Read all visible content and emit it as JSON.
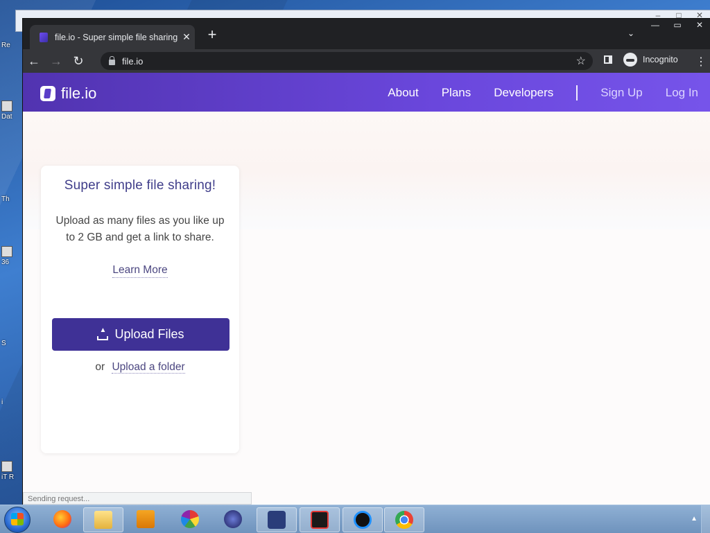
{
  "desktop": {
    "icons": [
      "Re",
      "Dat",
      "Th",
      "36",
      "S",
      "i",
      "iT R"
    ]
  },
  "browser": {
    "tab_title": "file.io - Super simple file sharing",
    "tab_close": "✕",
    "new_tab": "+",
    "url": "file.io",
    "profile_label": "Incognito",
    "status_text": "Sending request..."
  },
  "site": {
    "logo_text": "file.io",
    "nav": {
      "about": "About",
      "plans": "Plans",
      "developers": "Developers",
      "signup": "Sign Up",
      "login": "Log In"
    },
    "card": {
      "title": "Super simple file sharing!",
      "description": "Upload as many files as you like up to 2 GB and get a link to share.",
      "learn_more": "Learn More",
      "upload_button": "Upload Files",
      "or": "or",
      "upload_folder": "Upload a folder"
    }
  },
  "colors": {
    "navbar_start": "#5133b0",
    "navbar_end": "#7654ea",
    "upload_button": "#3f3196",
    "card_title": "#3f3d8a"
  }
}
